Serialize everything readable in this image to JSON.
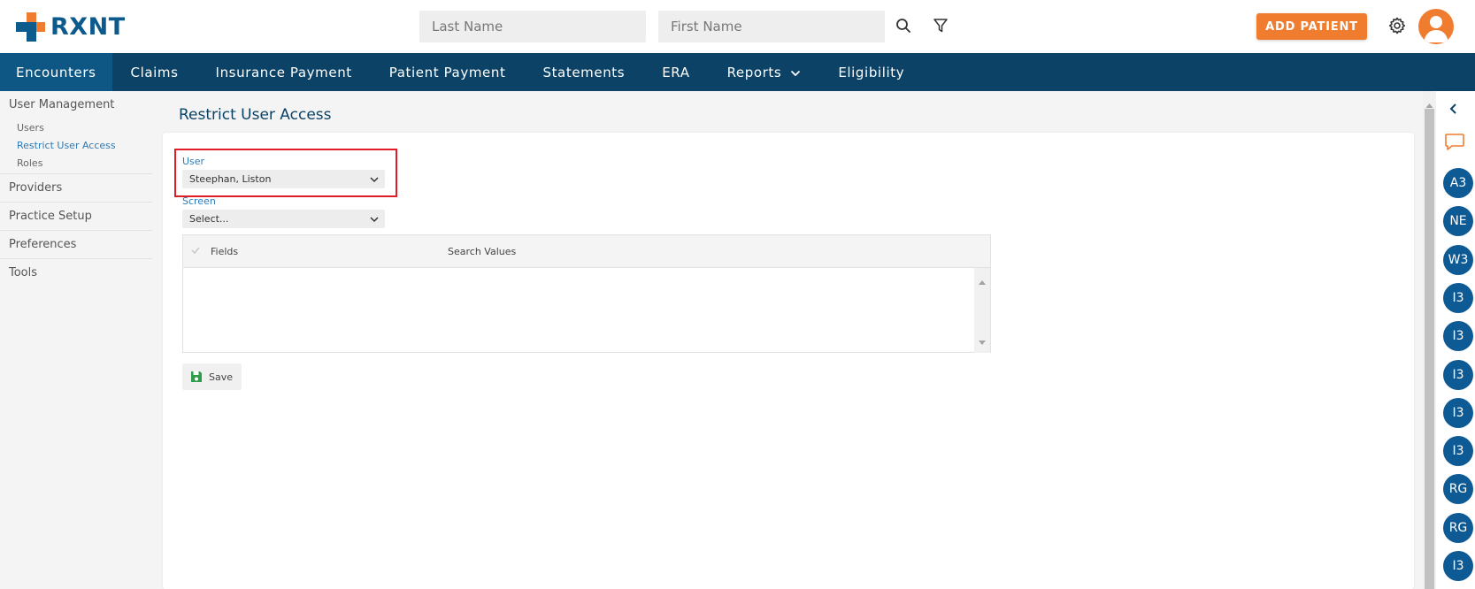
{
  "brand": {
    "name": "RXNT",
    "colors": {
      "primary": "#0b4266",
      "accent": "#f07c2f",
      "link": "#2a7ab8",
      "badge": "#0e5a95"
    }
  },
  "header": {
    "last_name_placeholder": "Last Name",
    "first_name_placeholder": "First Name",
    "search_icon": "search-icon",
    "filter_icon": "filter-icon",
    "add_patient_label": "ADD PATIENT",
    "settings_icon": "gear-icon",
    "avatar_icon": "user-avatar-icon"
  },
  "nav": {
    "items": [
      {
        "label": "Encounters",
        "active": true
      },
      {
        "label": "Claims"
      },
      {
        "label": "Insurance Payment"
      },
      {
        "label": "Patient Payment"
      },
      {
        "label": "Statements"
      },
      {
        "label": "ERA"
      },
      {
        "label": "Reports",
        "dropdown": true
      },
      {
        "label": "Eligibility"
      }
    ]
  },
  "sidebar": {
    "user_management": {
      "label": "User Management",
      "items": [
        {
          "label": "Users"
        },
        {
          "label": "Restrict User Access",
          "active": true
        },
        {
          "label": "Roles"
        }
      ]
    },
    "sections": [
      {
        "label": "Providers"
      },
      {
        "label": "Practice Setup"
      },
      {
        "label": "Preferences"
      },
      {
        "label": "Tools"
      }
    ]
  },
  "main": {
    "title": "Restrict User Access",
    "user_field": {
      "label": "User",
      "value": "Steephan, Liston"
    },
    "screen_field": {
      "label": "Screen",
      "value": "Select..."
    },
    "grid": {
      "columns": [
        "Fields",
        "Search Values"
      ],
      "rows": []
    },
    "save_label": "Save"
  },
  "rail": {
    "collapse_icon": "chevron-left-icon",
    "chat_icon": "chat-icon",
    "badges": [
      "A3",
      "NE",
      "W3",
      "I3",
      "I3",
      "I3",
      "I3",
      "I3",
      "RG",
      "RG",
      "I3"
    ]
  }
}
